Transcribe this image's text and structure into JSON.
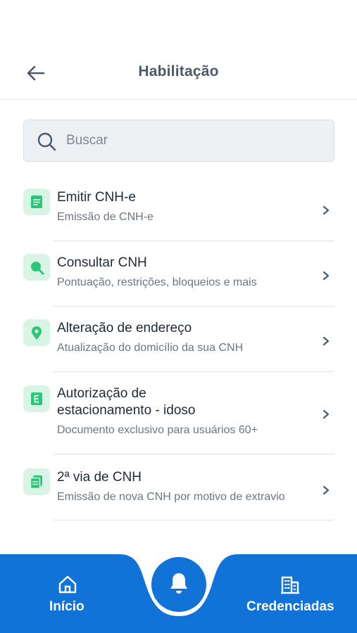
{
  "header": {
    "title": "Habilitação",
    "back_icon": "arrow-left-icon"
  },
  "search": {
    "placeholder": "Buscar"
  },
  "items": [
    {
      "title": "Emitir CNH-e",
      "subtitle": "Emissão de CNH-e",
      "icon": "document-icon"
    },
    {
      "title": "Consultar CNH",
      "subtitle": "Pontuação, restrições, bloqueios e mais",
      "icon": "search-icon"
    },
    {
      "title": "Alteração de endereço",
      "subtitle": "Atualização do domicílio da sua CNH",
      "icon": "location-pin-icon"
    },
    {
      "title_line1": "Autorização de",
      "title_line2": "estacionamento - idoso",
      "subtitle": "Documento exclusivo para usuários 60+",
      "icon": "letter-e-icon"
    },
    {
      "title": "2ª via de CNH",
      "subtitle": "Emissão de nova CNH por motivo de extravio",
      "icon": "copy-document-icon"
    }
  ],
  "bottom_nav": {
    "home_label": "Início",
    "partners_label": "Credenciadas",
    "center_icon": "bell-icon"
  },
  "colors": {
    "primary": "#1173d8",
    "icon_bg": "#d8f4e5",
    "icon_fg": "#2bc67a"
  }
}
